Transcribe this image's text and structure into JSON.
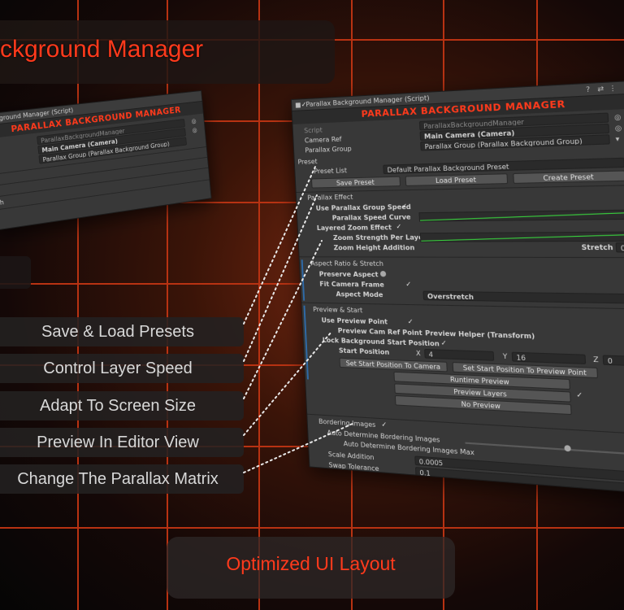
{
  "title": "ckground Manager",
  "captions": [
    "Save & Load Presets",
    "Control Layer Speed",
    "Adapt To Screen Size",
    "Preview In Editor View",
    "Change The Parallax Matrix"
  ],
  "footer": "Optimized UI Layout",
  "colors": {
    "accent": "#ff3a1c",
    "grid": "#b83212",
    "curve": "#39d43e"
  },
  "small_inspector": {
    "header": "ground Manager (Script)",
    "banner": "PARALLAX BACKGROUND MANAGER",
    "script_value": "ParallaxBackgroundManager",
    "camera_value": "Main Camera (Camera)",
    "group_value": "Parallax Group (Parallax Background Group)",
    "partial_row": "h"
  },
  "inspector": {
    "header": "Parallax Background Manager (Script)",
    "banner": "PARALLAX BACKGROUND MANAGER",
    "script_label": "Script",
    "script_value": "ParallaxBackgroundManager",
    "camera_label": "Camera Ref",
    "camera_value": "Main Camera (Camera)",
    "group_label": "Parallax Group",
    "group_value": "Parallax Group (Parallax Background Group)",
    "preset": {
      "section": "Preset",
      "list_label": "Preset List",
      "list_value": "Default Parallax Background Preset",
      "save": "Save Preset",
      "load": "Load Preset",
      "create": "Create Preset"
    },
    "effect": {
      "section": "Parallax Effect",
      "use_speed": "Use Parallax Group Speed",
      "speed_curve": "Parallax Speed Curve",
      "layered_zoom": "Layered Zoom Effect",
      "zoom_strength": "Zoom Strength Per Layer",
      "zoom_height": "Zoom Height Addition",
      "stretch": "Stretch",
      "stretch_value": "0"
    },
    "aspect": {
      "section": "Aspect Ratio & Stretch",
      "preserve": "Preserve Aspect",
      "fit": "Fit Camera Frame",
      "mode_label": "Aspect Mode",
      "mode_value": "Overstretch"
    },
    "preview": {
      "section": "Preview & Start",
      "use_point": "Use Preview Point",
      "cam_ref": "Preview Cam Ref Point",
      "cam_ref_value": "Preview Helper (Transform)",
      "lock_bg": "Lock Background Start Position",
      "start_pos": "Start Position",
      "x_label": "X",
      "x_value": "4",
      "y_label": "Y",
      "y_value": "16",
      "z_label": "Z",
      "z_value": "0",
      "set_cam": "Set Start Position To Camera",
      "set_preview": "Set Start Position To Preview Point",
      "runtime": "Runtime Preview",
      "layers": "Preview Layers",
      "none": "No Preview"
    },
    "bordering": {
      "section": "Bordering Images",
      "auto": "Auto Determine Bordering Images",
      "auto_max": "Auto Determine Bordering Images Max",
      "scale_label": "Scale Addition",
      "scale_value": "0.0005",
      "swap_label": "Swap Tolerance",
      "swap_value": "0.1"
    }
  }
}
